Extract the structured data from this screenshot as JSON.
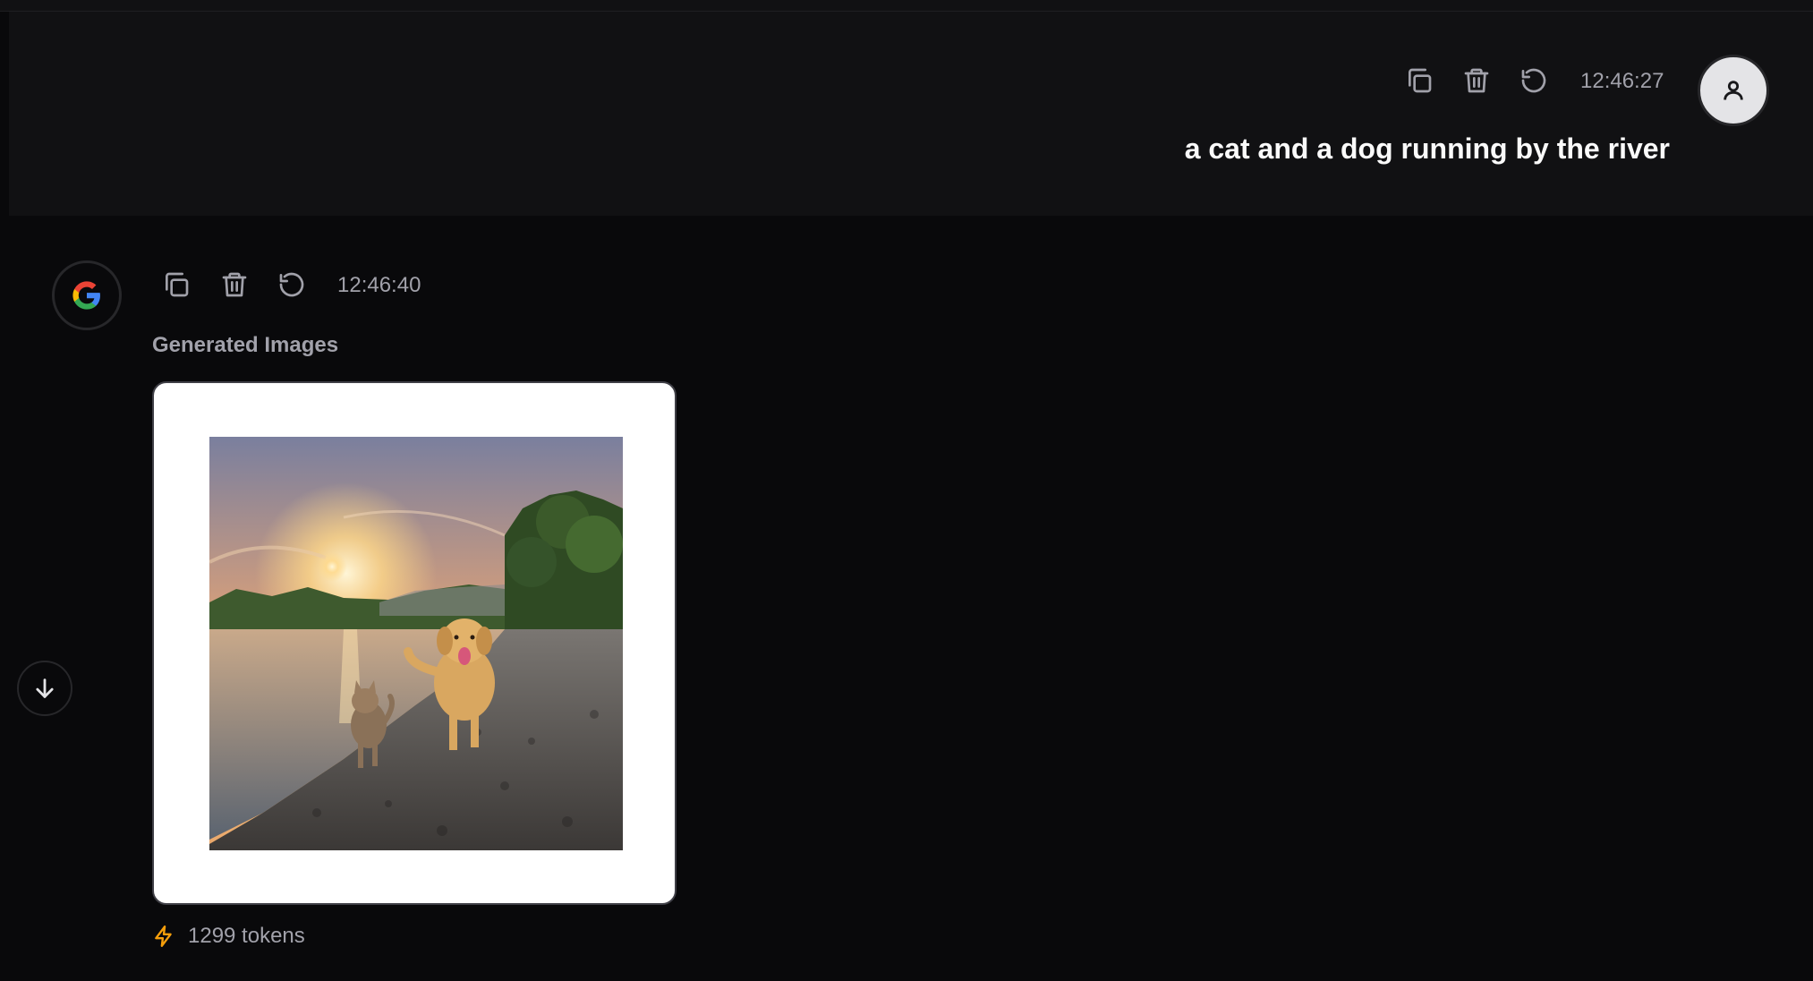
{
  "user_message": {
    "text": "a cat and a dog running by the river",
    "timestamp": "12:46:27",
    "actions": [
      "copy-icon",
      "trash-icon",
      "regenerate-icon"
    ],
    "avatar_icon": "user-icon"
  },
  "assistant_message": {
    "avatar_icon": "google-logo",
    "timestamp": "12:46:40",
    "actions": [
      "copy-icon",
      "trash-icon",
      "regenerate-icon"
    ],
    "section_label": "Generated Images",
    "token_count": "1299 tokens",
    "token_icon": "lightning-icon"
  },
  "scroll_button_icon": "arrow-down-icon",
  "colors": {
    "background": "#09090b",
    "user_bubble": "#111113",
    "muted_text": "#a1a1aa",
    "accent_token": "#f59e0b"
  }
}
